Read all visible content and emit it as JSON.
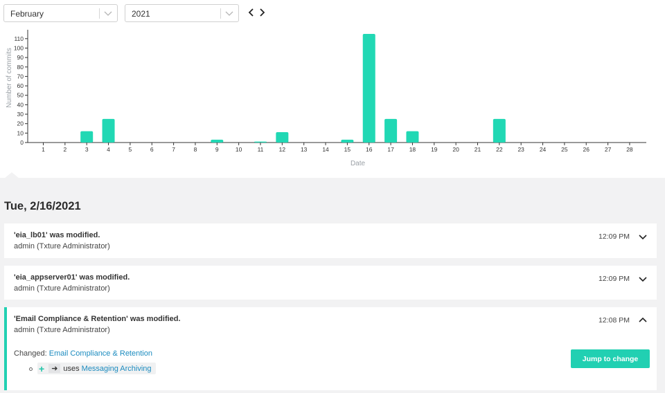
{
  "controls": {
    "month": "February",
    "year": "2021"
  },
  "chart_data": {
    "type": "bar",
    "categories": [
      "1",
      "2",
      "3",
      "4",
      "5",
      "6",
      "7",
      "8",
      "9",
      "10",
      "11",
      "12",
      "13",
      "14",
      "15",
      "16",
      "17",
      "18",
      "19",
      "20",
      "21",
      "22",
      "23",
      "24",
      "25",
      "26",
      "27",
      "28"
    ],
    "values": [
      0,
      0,
      12,
      25,
      0,
      0,
      0,
      0,
      3,
      0,
      1,
      11,
      0,
      0,
      3,
      115,
      25,
      12,
      0,
      0,
      0,
      25,
      0,
      0,
      0,
      0,
      0,
      0
    ],
    "xlabel": "Date",
    "ylabel": "Number of commits",
    "ylim": [
      0,
      115
    ],
    "yticks": [
      0,
      10,
      20,
      30,
      40,
      50,
      60,
      70,
      80,
      90,
      100,
      110
    ],
    "bar_color": "#21d8b4"
  },
  "feed": {
    "day": "Tue, 2/16/2021",
    "entries": [
      {
        "title": "'eia_lb01' was modified.",
        "author": "admin (Txture Administrator)",
        "time": "12:09 PM"
      },
      {
        "title": "'eia_appserver01' was modified.",
        "author": "admin (Txture Administrator)",
        "time": "12:09 PM"
      },
      {
        "title": "'Email Compliance & Retention' was modified.",
        "author": "admin (Txture Administrator)",
        "time": "12:08 PM",
        "changed_label": "Changed:",
        "changed_link": "Email Compliance & Retention",
        "relation_verb": "uses",
        "relation_target": "Messaging Archiving",
        "jump_label": "Jump to change"
      }
    ]
  },
  "colors": {
    "accent": "#21d0b2",
    "link": "#1b8bbf"
  }
}
